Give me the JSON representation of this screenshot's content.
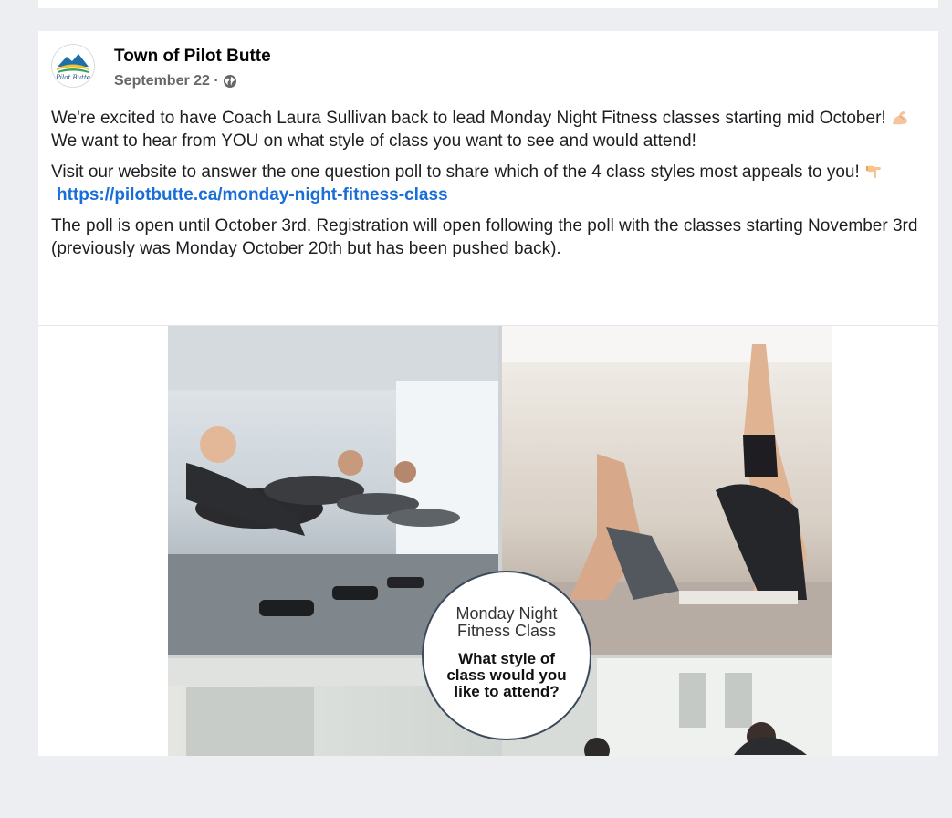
{
  "post": {
    "author": "Town of Pilot Butte",
    "avatar_text": "Pilot Butte",
    "date": "September 22 ·",
    "paragraphs": {
      "p1_a": "We're excited to have Coach Laura Sullivan back to lead Monday Night Fitness classes starting mid October! ",
      "p1_b": "We want to hear from YOU on what style of class you want to see and would attend!",
      "p2": "Visit our website to answer the one question poll to share which of the 4 class styles most appeals to you! ",
      "link": "https://pilotbutte.ca/monday-night-fitness-class",
      "p3": "The poll is open until October 3rd. Registration will open following the poll with the classes starting November 3rd (previously was Monday October 20th but has been pushed back)."
    },
    "image": {
      "circle_line1": "Monday Night",
      "circle_line2": "Fitness Class",
      "question_line1": "What style of",
      "question_line2": "class would you",
      "question_line3": "like to attend?"
    }
  },
  "icons": [
    "globe-icon",
    "flexed-biceps-emoji",
    "backhand-index-pointing-down-emoji"
  ],
  "colors": {
    "link": "#1a6ed8",
    "meta": "#65676b",
    "background": "#eceef1"
  }
}
